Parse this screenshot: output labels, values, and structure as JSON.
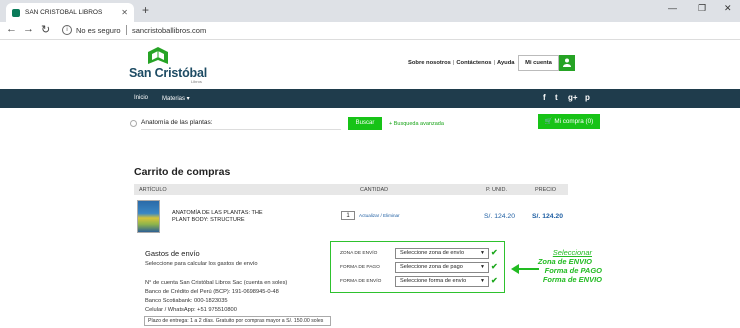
{
  "browser": {
    "tab_title": "SAN CRISTOBAL LIBROS",
    "tab_close": "✕",
    "new_tab": "+",
    "url_security": "No es seguro",
    "url": "sancristoballibros.com",
    "win_minimize": "—",
    "win_restore": "❐",
    "win_close": "✕",
    "back": "←",
    "forward": "→",
    "reload": "↻",
    "info": "i"
  },
  "header": {
    "logo_text": "San Cristóbal",
    "logo_sub": "Libros",
    "links": [
      "Sobre nosotros",
      "Contáctenos",
      "Ayuda"
    ],
    "account_label": "Mi cuenta",
    "account_icon": "user-icon"
  },
  "nav": {
    "items": [
      "Inicio",
      "Materias ▾"
    ],
    "social": [
      "f",
      "t",
      "g+",
      "p"
    ]
  },
  "search": {
    "value": "Anatomía de las plantas:",
    "button": "Buscar",
    "advanced": "+ Busqueda avanzada",
    "cart_label": "🛒 Mi compra (0)"
  },
  "cart": {
    "title": "Carrito de compras",
    "columns": [
      "ARTÍCULO",
      "CANTIDAD",
      "P. UNID.",
      "PRECIO"
    ],
    "item": {
      "title": "ANATOMÍA DE LAS PLANTAS: THE PLANT BODY: STRUCTURE",
      "quantity": "1",
      "action": "Actualizar / Eliminar",
      "unit_price": "S/. 124.20",
      "price": "S/. 124.20"
    }
  },
  "shipping": {
    "title": "Gastos de envío",
    "subtitle": "Seleccione para calcular los gastos de envío",
    "bank_lines": [
      "N° de cuenta San Cristóbal Libros Sac (cuenta en soles)",
      "Banco de Crédito del Perú (BCP): 191-0698945-0-48",
      "Banco Scotiabank: 000-1823035",
      "Celular / WhatsApp: +51 975510800"
    ],
    "delivery_note": "Plazo de entrega: 1 a 2 días. Gratuito por compras mayor a S/. 150.00 soles",
    "rows": [
      {
        "label": "ZONA DE ENVÍO",
        "value": "Seleccione zona de envío"
      },
      {
        "label": "FORMA DE PAGO",
        "value": "Seleccione zona de pago"
      },
      {
        "label": "FORMA DE ENVÍO",
        "value": "Seleccione forma de envío"
      }
    ],
    "check": "✔"
  },
  "annotation": {
    "line1": "Seleccionar",
    "line2": "Zona de ENVIO",
    "line3": "Forma de PAGO",
    "line4": "Forma de ENVIO"
  },
  "colors": {
    "brand_dark": "#1f3c4c",
    "accent_green": "#17c317",
    "price_blue": "#1f5fa3"
  }
}
